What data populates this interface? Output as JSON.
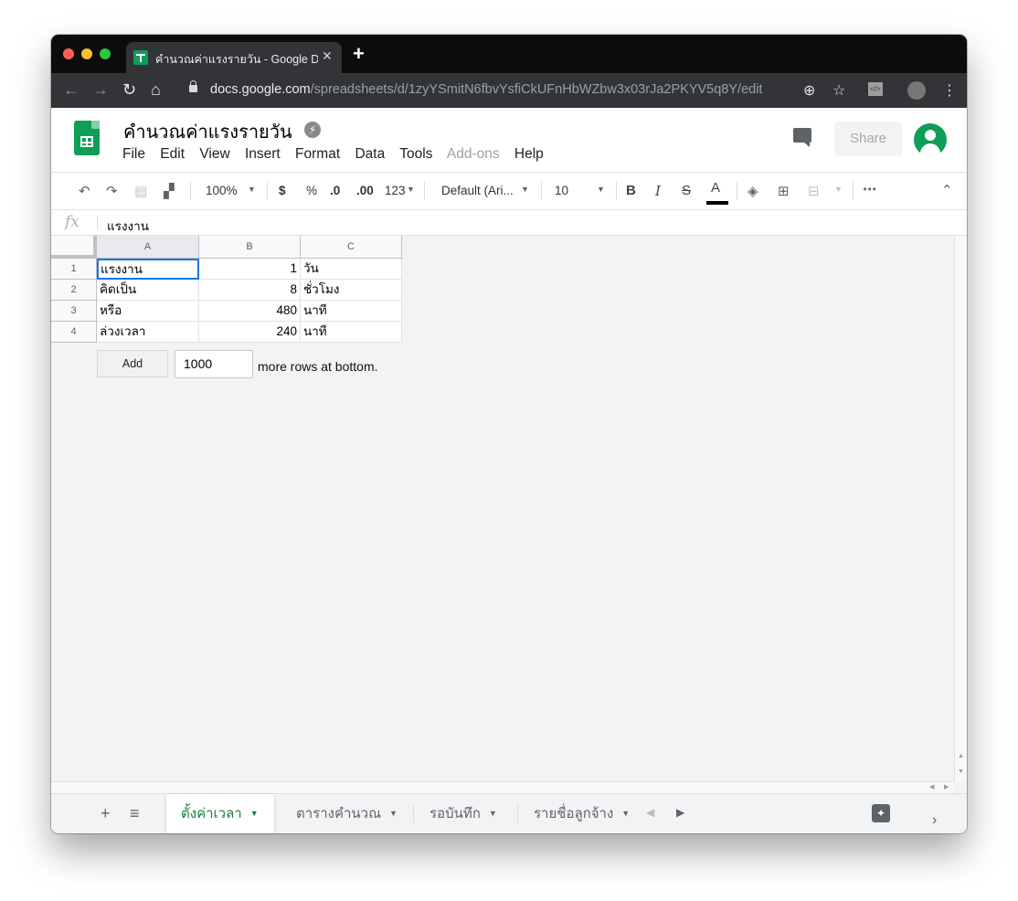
{
  "browser": {
    "tab_title": "คำนวณค่าแรงรายวัน - Google Drive",
    "url_host": "docs.google.com",
    "url_path": "/spreadsheets/d/1zyYSmitN6fbvYsfiCkUFnHbWZbw3x03rJa2PKYV5q8Y/edit"
  },
  "doc": {
    "title": "คำนวณค่าแรงรายวัน",
    "share_label": "Share",
    "menu": [
      "File",
      "Edit",
      "View",
      "Insert",
      "Format",
      "Data",
      "Tools",
      "Add-ons",
      "Help"
    ]
  },
  "toolbar": {
    "zoom": "100%",
    "currency": "$",
    "percent": "%",
    "dec_less": ".0",
    "dec_more": ".00",
    "more_formats": "123",
    "font": "Default (Ari...",
    "font_size": "10",
    "bold": "B",
    "italic": "I",
    "strike": "S",
    "text_color": "A",
    "more": "⋯"
  },
  "formula_bar": {
    "fx": "fx",
    "value": "แรงงาน"
  },
  "grid": {
    "columns": [
      "A",
      "B",
      "C"
    ],
    "rows": [
      {
        "num": "1",
        "a": "แรงงาน",
        "b": "1",
        "c": "วัน"
      },
      {
        "num": "2",
        "a": "คิดเป็น",
        "b": "8",
        "c": "ชั่วโมง"
      },
      {
        "num": "3",
        "a": "หรือ",
        "b": "480",
        "c": "นาที"
      },
      {
        "num": "4",
        "a": "ล่วงเวลา",
        "b": "240",
        "c": "นาที"
      }
    ],
    "add_label": "Add",
    "add_rows_value": "1000",
    "add_rows_text": "more rows at bottom."
  },
  "sheets": {
    "tabs": [
      "ตั้งค่าเวลา",
      "ตารางคำนวณ",
      "รอบันทึก",
      "รายชื่อลูกจ้าง"
    ]
  },
  "colors": {
    "accent_green": "#188038",
    "sheets_green": "#0f9d58",
    "selection_blue": "#1a73e8"
  }
}
